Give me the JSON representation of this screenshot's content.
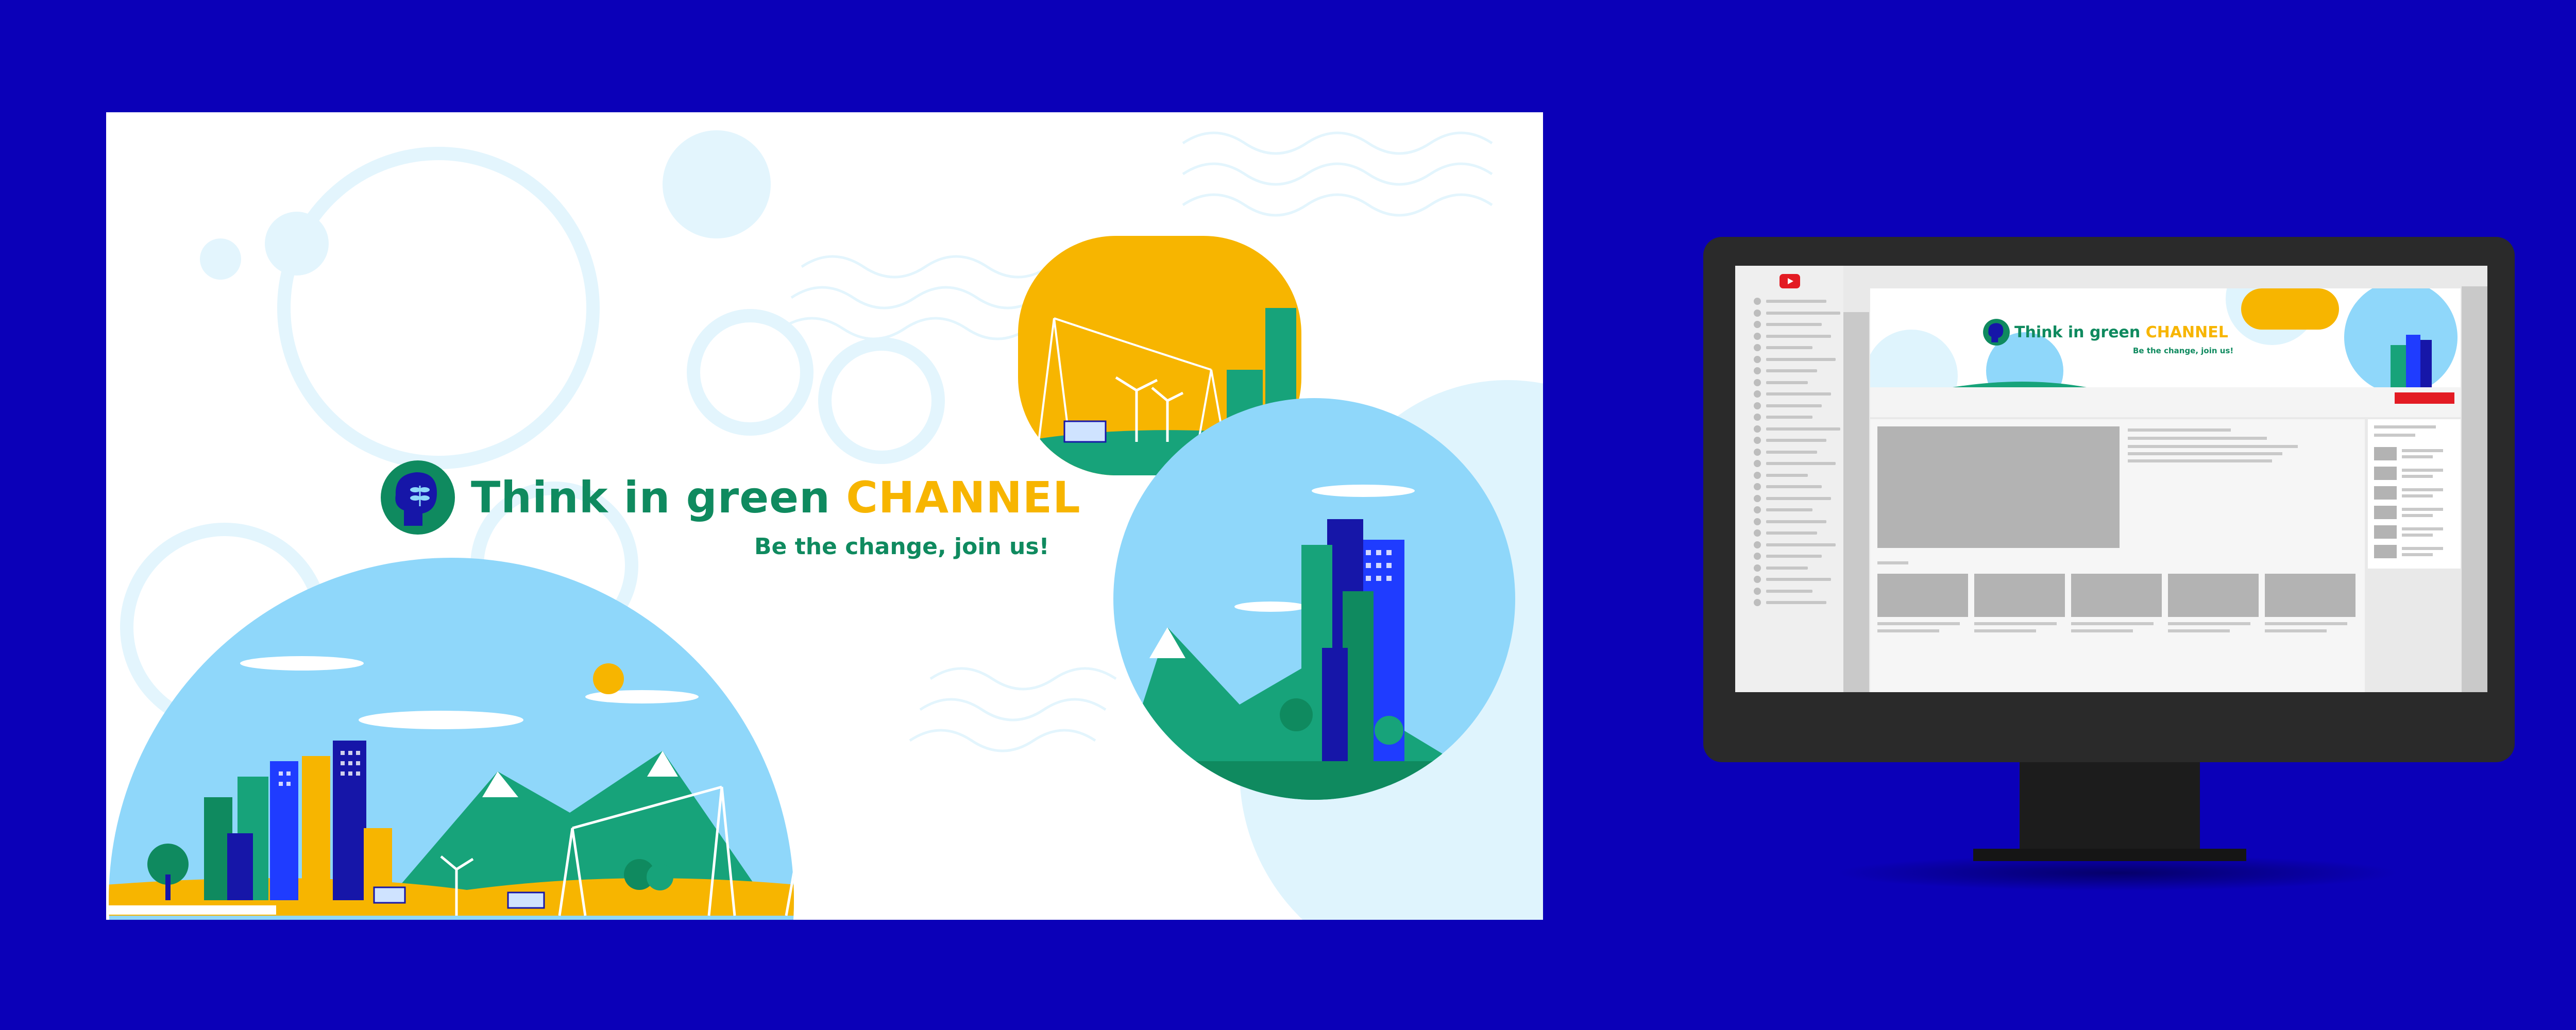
{
  "banner": {
    "title_main": "Think in green",
    "title_accent": "CHANNEL",
    "slogan": "Be the change, join us!"
  },
  "preview": {
    "title_main": "Think in green",
    "title_accent": "CHANNEL",
    "slogan": "Be the change, join us!"
  },
  "colors": {
    "background": "#0b00b8",
    "brand_green": "#0f8a5f",
    "brand_yellow": "#f7b500",
    "sky_blue": "#8fd7fa",
    "light_blue": "#dff4fd",
    "navy": "#1616a8",
    "youtube_red": "#e31b23",
    "monitor_bezel": "#2a2a2a"
  },
  "icons": [
    "head-plant-logo-icon",
    "youtube-logo-icon"
  ]
}
